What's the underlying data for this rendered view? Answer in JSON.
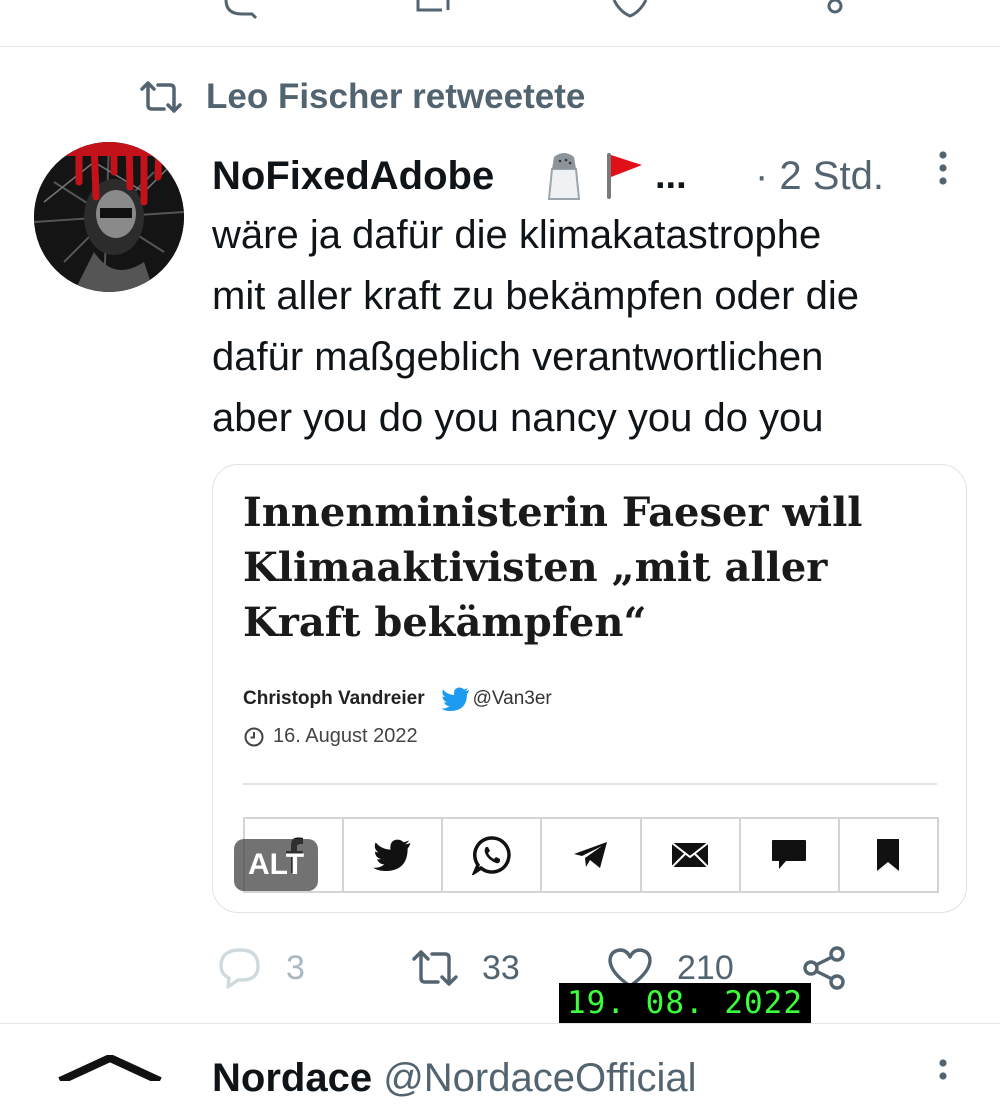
{
  "retweet": {
    "label": "Leo Fischer retweetete"
  },
  "tweet": {
    "author_name": "NoFixedAdobe",
    "author_emojis": [
      "salt-shaker-icon",
      "red-flag-icon"
    ],
    "ellipsis": "...",
    "time": "· 2 Std.",
    "text_lines": [
      "wäre ja dafür die klimakatastrophe",
      "mit aller kraft zu bekämpfen oder die",
      "dafür maßgeblich verantwortlichen",
      "aber you do you nancy you do you"
    ]
  },
  "media": {
    "headline_lines": [
      "Innenministerin Faeser will",
      "Klimaaktivisten „mit aller",
      "Kraft bekämpfen“"
    ],
    "byline_name": "Christoph Vandreier",
    "byline_handle": "@Van3er",
    "date": "16. August 2022",
    "share_icons": [
      "facebook-icon",
      "twitter-icon",
      "whatsapp-icon",
      "telegram-icon",
      "mail-icon",
      "comment-icon",
      "bookmark-icon"
    ],
    "alt_badge": "ALT"
  },
  "actions": {
    "replies": "3",
    "retweets": "33",
    "likes": "210"
  },
  "overlay": {
    "timestamp": "19. 08. 2022"
  },
  "next_tweet": {
    "author_name": "Nordace",
    "handle": "@NordaceOfficial"
  },
  "colors": {
    "text": "#0f1419",
    "secondary": "#536471",
    "twitter_blue": "#1d9bf0",
    "timestamp_green": "#3cff3c"
  }
}
